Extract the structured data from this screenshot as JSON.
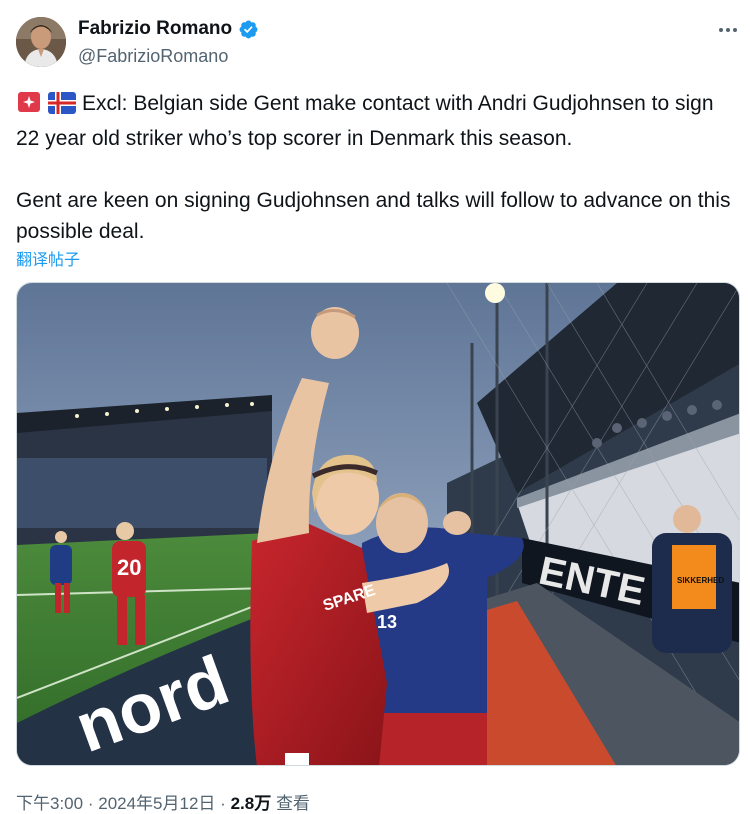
{
  "author": {
    "name": "Fabrizio Romano",
    "handle": "@FabrizioRomano"
  },
  "tweet": {
    "paragraph1": "Excl: Belgian side Gent make contact with Andri Gudjohnsen to sign 22 year old striker who’s top scorer in Denmark this season.",
    "paragraph2": "Gent are keen on signing Gudjohnsen and talks will follow to advance on this possible deal.",
    "translate_label": "翻译帖子"
  },
  "photo": {
    "shirt_number_back": "20",
    "shirt_number_front": "13",
    "banner_text": "ENTE",
    "sponsor_text": "SPARE",
    "steward_vest_text": "SIKKERHED"
  },
  "meta": {
    "time": "下午3:00",
    "date": "2024年5月12日",
    "views_count": "2.8万",
    "views_label": "查看",
    "separator": "·"
  },
  "colors": {
    "text": "#0f1419",
    "secondary": "#536471",
    "link": "#1d9bf0",
    "verified": "#1d9bf0"
  },
  "icons": {
    "alert": "rotating-light-icon",
    "flag": "iceland-flag-icon",
    "verified": "verified-badge-icon",
    "more": "more-options-icon"
  }
}
